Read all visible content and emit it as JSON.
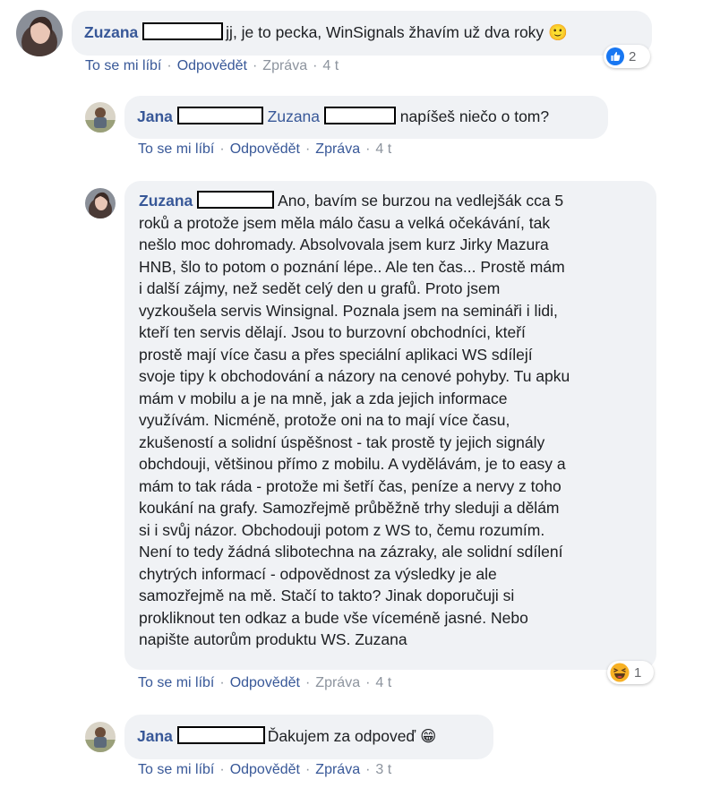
{
  "comments": [
    {
      "author": "Zuzana",
      "text": "jj, je to pecka, WinSignals žhavím už dva roky",
      "emoji": "🙂",
      "actions": {
        "like": "To se mi líbí",
        "reply": "Odpovědět",
        "message": "Zpráva",
        "time": "4 t"
      },
      "reaction": {
        "icon": "thumbs-up",
        "count": "2"
      }
    },
    {
      "author": "Jana",
      "mention": "Zuzana",
      "text": "napíšeš niečo o tom?",
      "actions": {
        "like": "To se mi líbí",
        "reply": "Odpovědět",
        "message": "Zpráva",
        "time": "4 t"
      }
    },
    {
      "author": "Zuzana",
      "lines": [
        "Ano, bavím se burzou na vedlejšák cca 5",
        "roků a protože jsem měla málo času a velká očekávání, tak",
        "nešlo moc dohromady. Absolvovala jsem kurz Jirky Mazura",
        "HNB, šlo to potom o poznání lépe.. Ale ten čas... Prostě mám",
        "i další zájmy, než sedět celý den u grafů. Proto jsem",
        "vyzkoušela servis Winsignal. Poznala jsem na semináři i lidi,",
        "kteří ten servis dělají. Jsou to burzovní obchodníci, kteří",
        "prostě mají více času a přes speciální aplikaci WS sdílejí",
        "svoje tipy k obchodování a názory na cenové pohyby. Tu apku",
        "mám v mobilu a je na mně, jak a zda jejich informace",
        "využívám. Nicméně, protože oni na to mají více času,",
        "zkušeností a solidní úspěšnost - tak prostě ty jejich signály",
        "obchdouji, většinou přímo z mobilu. A vydělávám, je to easy a",
        "mám to tak ráda - protože mi šetří čas, peníze a nervy z toho",
        "koukání na grafy. Samozřejmě průběžně trhy sleduji a dělám",
        "si i svůj názor. Obchodouji potom z WS to, čemu rozumím.",
        "Není to tedy žádná slibotechna na zázraky, ale solidní sdílení",
        "chytrých informací - odpovědnost za výsledky je ale",
        "samozřejmě na mě. Stačí to takto? Jinak doporučuji si",
        "prokliknout ten odkaz a bude vše víceméně jasné. Nebo",
        "napište autorům produktu WS. Zuzana"
      ],
      "actions": {
        "like": "To se mi líbí",
        "reply": "Odpovědět",
        "message": "Zpráva",
        "time": "4 t"
      },
      "reaction": {
        "icon": "laughing-face",
        "count": "1"
      }
    },
    {
      "author": "Jana",
      "text": "Ďakujem za odpoveď",
      "emoji": "😁",
      "actions": {
        "like": "To se mi líbí",
        "reply": "Odpovědět",
        "message": "Zpráva",
        "time": "3 t"
      }
    }
  ],
  "colors": {
    "bubble": "#f0f2f5",
    "name": "#385898",
    "meta": "#8d949e",
    "like": "#1877f2"
  }
}
